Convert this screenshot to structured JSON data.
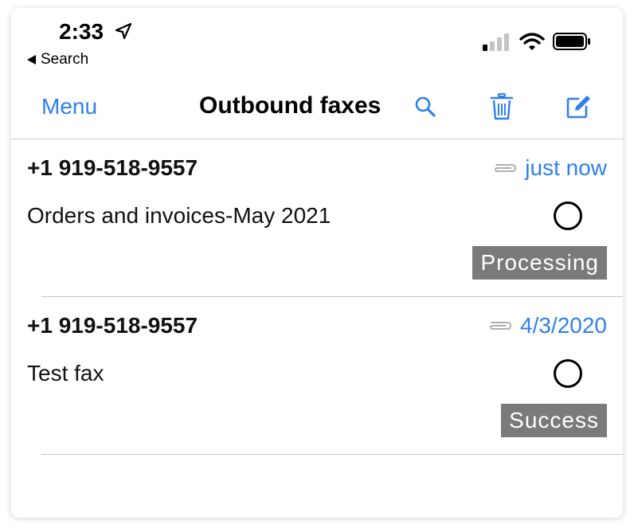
{
  "status_bar": {
    "time": "2:33",
    "back_app_label": "Search"
  },
  "nav": {
    "menu_label": "Menu",
    "title": "Outbound faxes",
    "icons": [
      "search-icon",
      "trash-icon",
      "compose-icon"
    ]
  },
  "faxes": [
    {
      "number": "+1 919-518-9557",
      "date": "just now",
      "subject": "Orders and invoices-May 2021",
      "status": "Processing"
    },
    {
      "number": "+1 919-518-9557",
      "date": "4/3/2020",
      "subject": "Test fax",
      "status": "Success"
    }
  ],
  "colors": {
    "accent": "#2f80ed",
    "badge_bg": "#7a7a7a",
    "divider": "#c8c8c8"
  }
}
